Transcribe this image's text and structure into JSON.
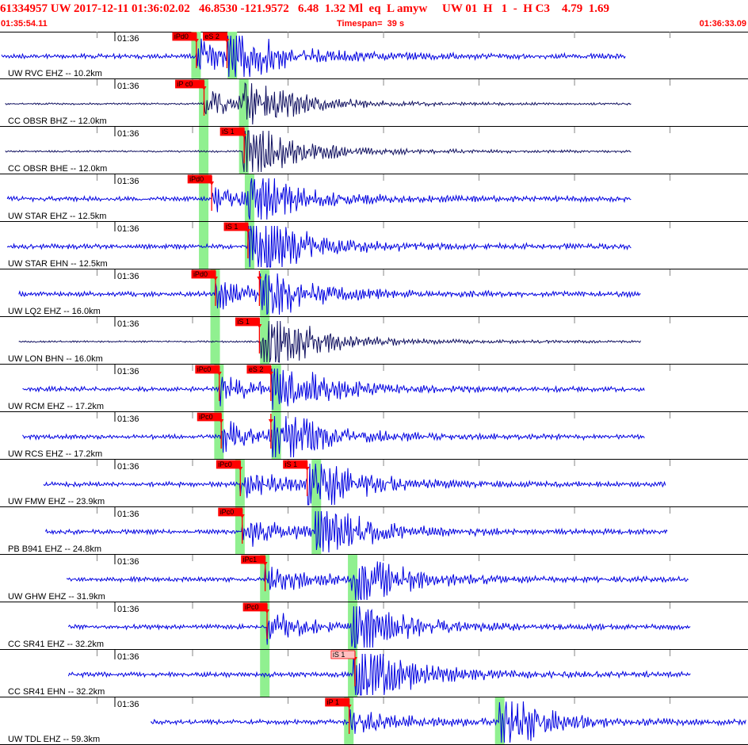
{
  "header": {
    "title": "61334957 UW 2017-12-11 01:36:02.02   46.8530 -121.9572   6.48  1.32 Ml  eq  L amyw     UW 01  H   1  -  H C3    4.79  1.69",
    "start_time": "01:35:54.11",
    "timespan": "Timespan=  39 s",
    "end_time": "01:36:33.09"
  },
  "colors": {
    "trace": "#0000e0",
    "trace_dark": "#101060",
    "pick": "#ff0000",
    "pick_weak": "#ffc0c0",
    "window": "#90f090",
    "text": "#000000",
    "grid": "#000000"
  },
  "time_label": "01:36",
  "chart_data": {
    "type": "line",
    "title": "",
    "xlabel": "",
    "ylabel": "",
    "xlim_s": [
      0,
      39
    ],
    "panels": [
      {
        "label": "UW RVC EHZ -- 10.2km",
        "color": "blue",
        "trace_start": 0.0,
        "trace_end": 32.7,
        "picks": [
          {
            "phase": "iPd0",
            "t": 10.2
          },
          {
            "phase": "eS 2",
            "t": 11.8
          }
        ],
        "green": [
          10.1,
          12.0
        ]
      },
      {
        "label": "CC OBSR BHZ -- 12.0km",
        "color": "dark",
        "trace_start": 0.2,
        "trace_end": 33.0,
        "picks": [
          {
            "phase": "iP c0",
            "t": 10.6
          }
        ],
        "green": [
          10.5,
          12.6
        ]
      },
      {
        "label": "CC OBSR BHE -- 12.0km",
        "color": "dark",
        "trace_start": 0.2,
        "trace_end": 33.0,
        "picks": [
          {
            "phase": "iS 1",
            "t": 12.7
          }
        ],
        "green": [
          10.5,
          12.6
        ]
      },
      {
        "label": "UW STAR EHZ -- 12.5km",
        "color": "blue",
        "trace_start": 0.3,
        "trace_end": 33.0,
        "picks": [
          {
            "phase": "iPd0",
            "t": 11.0
          }
        ],
        "green": [
          10.5,
          12.9
        ]
      },
      {
        "label": "UW STAR EHN -- 12.5km",
        "color": "blue",
        "trace_start": 0.3,
        "trace_end": 33.0,
        "picks": [
          {
            "phase": "iS 1",
            "t": 12.9
          }
        ],
        "green": [
          10.5,
          12.9
        ]
      },
      {
        "label": "UW LQ2 EHZ -- 16.0km",
        "color": "blue",
        "trace_start": 0.9,
        "trace_end": 33.5,
        "picks": [
          {
            "phase": "iPd0",
            "t": 11.2
          },
          {
            "phase": "",
            "t": 13.5
          }
        ],
        "green": [
          11.1,
          13.7
        ]
      },
      {
        "label": "UW LON BHN -- 16.0km",
        "color": "dark",
        "trace_start": 0.9,
        "trace_end": 33.5,
        "picks": [
          {
            "phase": "iS 1",
            "t": 13.5
          }
        ],
        "green": [
          11.1,
          13.7
        ]
      },
      {
        "label": "UW RCM EHZ -- 17.2km",
        "color": "blue",
        "trace_start": 1.1,
        "trace_end": 33.7,
        "picks": [
          {
            "phase": "iPc0",
            "t": 11.4
          },
          {
            "phase": "eS 2",
            "t": 14.1
          }
        ],
        "green": [
          11.3,
          14.3
        ]
      },
      {
        "label": "UW RCS EHZ -- 17.2km",
        "color": "blue",
        "trace_start": 1.1,
        "trace_end": 33.7,
        "picks": [
          {
            "phase": "iPc0",
            "t": 11.5
          },
          {
            "phase": "",
            "t": 14.1
          }
        ],
        "green": [
          11.3,
          14.3
        ]
      },
      {
        "label": "UW FMW EHZ -- 23.9km",
        "color": "blue",
        "trace_start": 2.2,
        "trace_end": 34.8,
        "picks": [
          {
            "phase": "iPc0",
            "t": 12.5
          },
          {
            "phase": "iS 1",
            "t": 16.0
          }
        ],
        "green": [
          12.4,
          16.4
        ]
      },
      {
        "label": "PB B941 EHZ -- 24.8km",
        "color": "blue",
        "trace_start": 2.3,
        "trace_end": 34.9,
        "picks": [
          {
            "phase": "iPc0",
            "t": 12.6
          }
        ],
        "green": [
          12.4,
          16.4
        ]
      },
      {
        "label": "UW GHW EHZ -- 31.9km",
        "color": "blue",
        "trace_start": 3.4,
        "trace_end": 36.0,
        "picks": [
          {
            "phase": "iPc1",
            "t": 13.8
          }
        ],
        "green": [
          13.7,
          18.3
        ]
      },
      {
        "label": "CC SR41 EHZ -- 32.2km",
        "color": "blue",
        "trace_start": 3.5,
        "trace_end": 36.1,
        "picks": [
          {
            "phase": "iPc0",
            "t": 13.9
          }
        ],
        "green": [
          13.7,
          18.3
        ]
      },
      {
        "label": "CC SR41 EHN -- 32.2km",
        "color": "blue",
        "trace_start": 3.5,
        "trace_end": 36.1,
        "picks": [
          {
            "phase": "iS 1",
            "t": 18.5
          }
        ],
        "green": [
          13.7,
          18.3
        ]
      },
      {
        "label": "UW TDL EHZ -- 59.3km",
        "color": "blue",
        "trace_start": 7.8,
        "trace_end": 39.0,
        "picks": [
          {
            "phase": "iP 1",
            "t": 18.2
          }
        ],
        "green": [
          18.1,
          26.0
        ]
      }
    ]
  }
}
